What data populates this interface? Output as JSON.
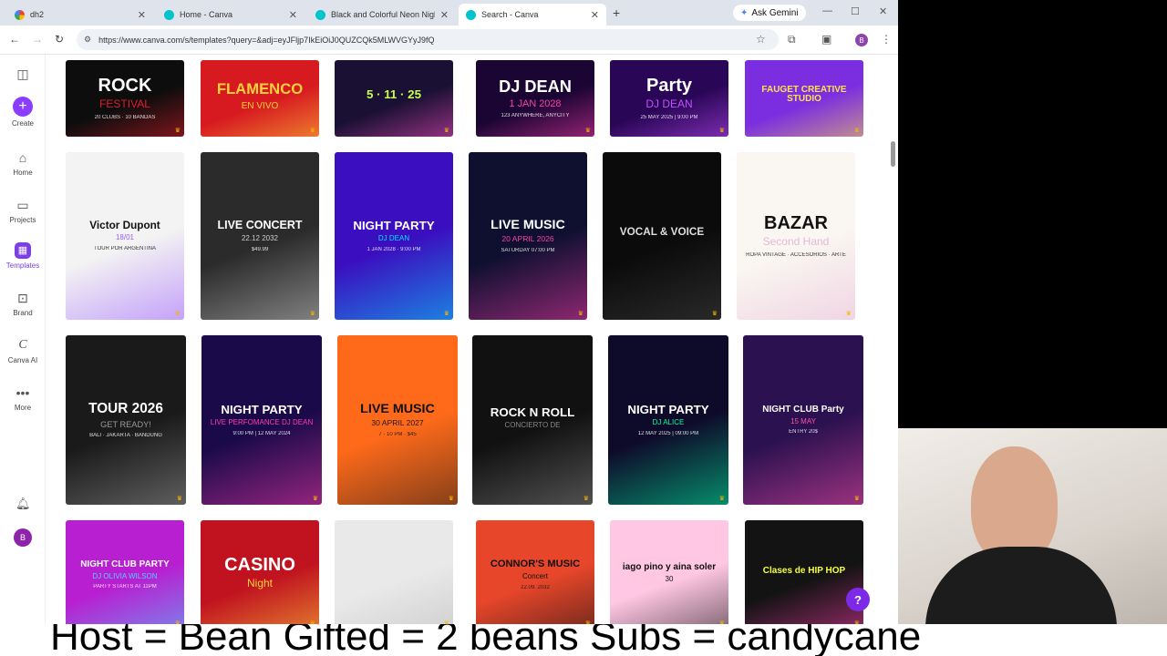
{
  "browser": {
    "tabs": [
      {
        "title": "dh2",
        "active": false
      },
      {
        "title": "Home - Canva",
        "active": false
      },
      {
        "title": "Black and Colorful Neon Night",
        "active": false
      },
      {
        "title": "Search - Canva",
        "active": true
      }
    ],
    "new_tab": "+",
    "ask_gemini": "Ask Gemini",
    "url": "https://www.canva.com/s/templates?query=&adj=eyJFljp7IkEiOiJ0QUZCQk5MLWVGYyJ9fQ",
    "profile_initial": "B"
  },
  "sidebar": {
    "create": "Create",
    "home": "Home",
    "projects": "Projects",
    "templates": "Templates",
    "brand": "Brand",
    "canva_ai": "Canva AI",
    "more": "More",
    "avatar_initial": "B"
  },
  "templates": {
    "row1": [
      {
        "t1": "ROCK",
        "t2": "FESTIVAL",
        "t3": "20 CLUBS · 10 BANDAS",
        "bg": "#0d0d0d",
        "fg": "#ffffff",
        "accent": "#e11d2b"
      },
      {
        "t1": "FLAMENCO",
        "t2": "EN VIVO",
        "t3": "",
        "bg": "#d71920",
        "fg": "#ffd23c",
        "accent": "#ffd23c"
      },
      {
        "t1": "5 · 11 · 25",
        "t2": "",
        "t3": "",
        "bg": "#1a1033",
        "fg": "#c8ff4d",
        "accent": "#ff4fc6"
      },
      {
        "t1": "DJ DEAN",
        "t2": "1 JAN 2028",
        "t3": "123 ANYWHERE, ANYCITY",
        "bg": "#1a0533",
        "fg": "#ffffff",
        "accent": "#ff3cac"
      },
      {
        "t1": "Party",
        "t2": "DJ DEAN",
        "t3": "25 MAY 2025 | 9:00 PM",
        "bg": "#2a0657",
        "fg": "#ffffff",
        "accent": "#c44dff"
      },
      {
        "t1": "FAUGET CREATIVE STUDIO",
        "t2": "",
        "t3": "",
        "bg": "#7a2ee0",
        "fg": "#ffe14d",
        "accent": "#ffe14d"
      }
    ],
    "row2": [
      {
        "t1": "Victor Dupont",
        "t2": "18/01",
        "t3": "TOUR POR ARGENTINA",
        "bg": "#f3f3f3",
        "fg": "#111111",
        "accent": "#9b59ff"
      },
      {
        "t1": "LIVE CONCERT",
        "t2": "22.12 2032",
        "t3": "$49.99",
        "bg": "#2b2b2b",
        "fg": "#ffffff",
        "accent": "#cccccc"
      },
      {
        "t1": "NIGHT PARTY",
        "t2": "DJ DEAN",
        "t3": "1 JAN 2028 · 9:00 PM",
        "bg": "#3b0fbf",
        "fg": "#ffffff",
        "accent": "#00e5ff"
      },
      {
        "t1": "LIVE MUSIC",
        "t2": "20 APRIL 2026",
        "t3": "SATURDAY 07:00 PM",
        "bg": "#0f1030",
        "fg": "#ffffff",
        "accent": "#ff3cac"
      },
      {
        "t1": "VOCAL & VOICE",
        "t2": "",
        "t3": "",
        "bg": "#0b0b0b",
        "fg": "#dddddd",
        "accent": "#444444"
      },
      {
        "t1": "BAZAR",
        "t2": "Second Hand",
        "t3": "ROPA VINTAGE · ACCESORIOS · ARTE",
        "bg": "#faf7f2",
        "fg": "#111111",
        "accent": "#e7b7d6"
      }
    ],
    "row3": [
      {
        "t1": "TOUR 2026",
        "t2": "GET READY!",
        "t3": "BALI · JAKARTA · BANDUNG",
        "bg": "#1a1a1a",
        "fg": "#ffffff",
        "accent": "#9a9a9a"
      },
      {
        "t1": "NIGHT PARTY",
        "t2": "LIVE PERFOMANCE DJ DEAN",
        "t3": "9:00 PM | 12 MAY 2024",
        "bg": "#1b0a4a",
        "fg": "#ffffff",
        "accent": "#ff3cac"
      },
      {
        "t1": "LIVE MUSIC",
        "t2": "30 APRIL 2027",
        "t3": "7 - 10 PM · $45",
        "bg": "#ff6a1a",
        "fg": "#111111",
        "accent": "#1a1a1a"
      },
      {
        "t1": "ROCK N ROLL",
        "t2": "CONCIERTO DE",
        "t3": "",
        "bg": "#111111",
        "fg": "#ffffff",
        "accent": "#888888"
      },
      {
        "t1": "NIGHT PARTY",
        "t2": "DJ ALICE",
        "t3": "12 MAY 2025 | 09:00 PM",
        "bg": "#0e0a2a",
        "fg": "#ffffff",
        "accent": "#00ffa2"
      },
      {
        "t1": "NIGHT CLUB Party",
        "t2": "15 MAY",
        "t3": "ENTRY 20$",
        "bg": "#2b1150",
        "fg": "#ffffff",
        "accent": "#ff4fa8"
      }
    ],
    "row4": [
      {
        "t1": "NIGHT CLUB PARTY",
        "t2": "DJ OLIVIA WILSON",
        "t3": "PARTY STARTS AT 11PM",
        "bg": "#b81fd1",
        "fg": "#ffffff",
        "accent": "#4dd2ff"
      },
      {
        "t1": "CASINO",
        "t2": "Night",
        "t3": "",
        "bg": "#c0121f",
        "fg": "#ffffff",
        "accent": "#ffd23c"
      },
      {
        "t1": "",
        "t2": "",
        "t3": "",
        "bg": "#e9e9e9",
        "fg": "#333333",
        "accent": "#bbbbbb"
      },
      {
        "t1": "CONNOR'S MUSIC",
        "t2": "Concert",
        "t3": "22.09. 2032",
        "bg": "#e8462a",
        "fg": "#111111",
        "accent": "#111111"
      },
      {
        "t1": "iago pino y aina soler",
        "t2": "30",
        "t3": "",
        "bg": "#ffc7e3",
        "fg": "#111111",
        "accent": "#111111"
      },
      {
        "t1": "Clases de HIP HOP",
        "t2": "",
        "t3": "",
        "bg": "#131313",
        "fg": "#f5ff3c",
        "accent": "#ff3cac"
      }
    ]
  },
  "help_label": "?",
  "caption": "Host = Bean  Gifted = 2 beans Subs = candycane"
}
